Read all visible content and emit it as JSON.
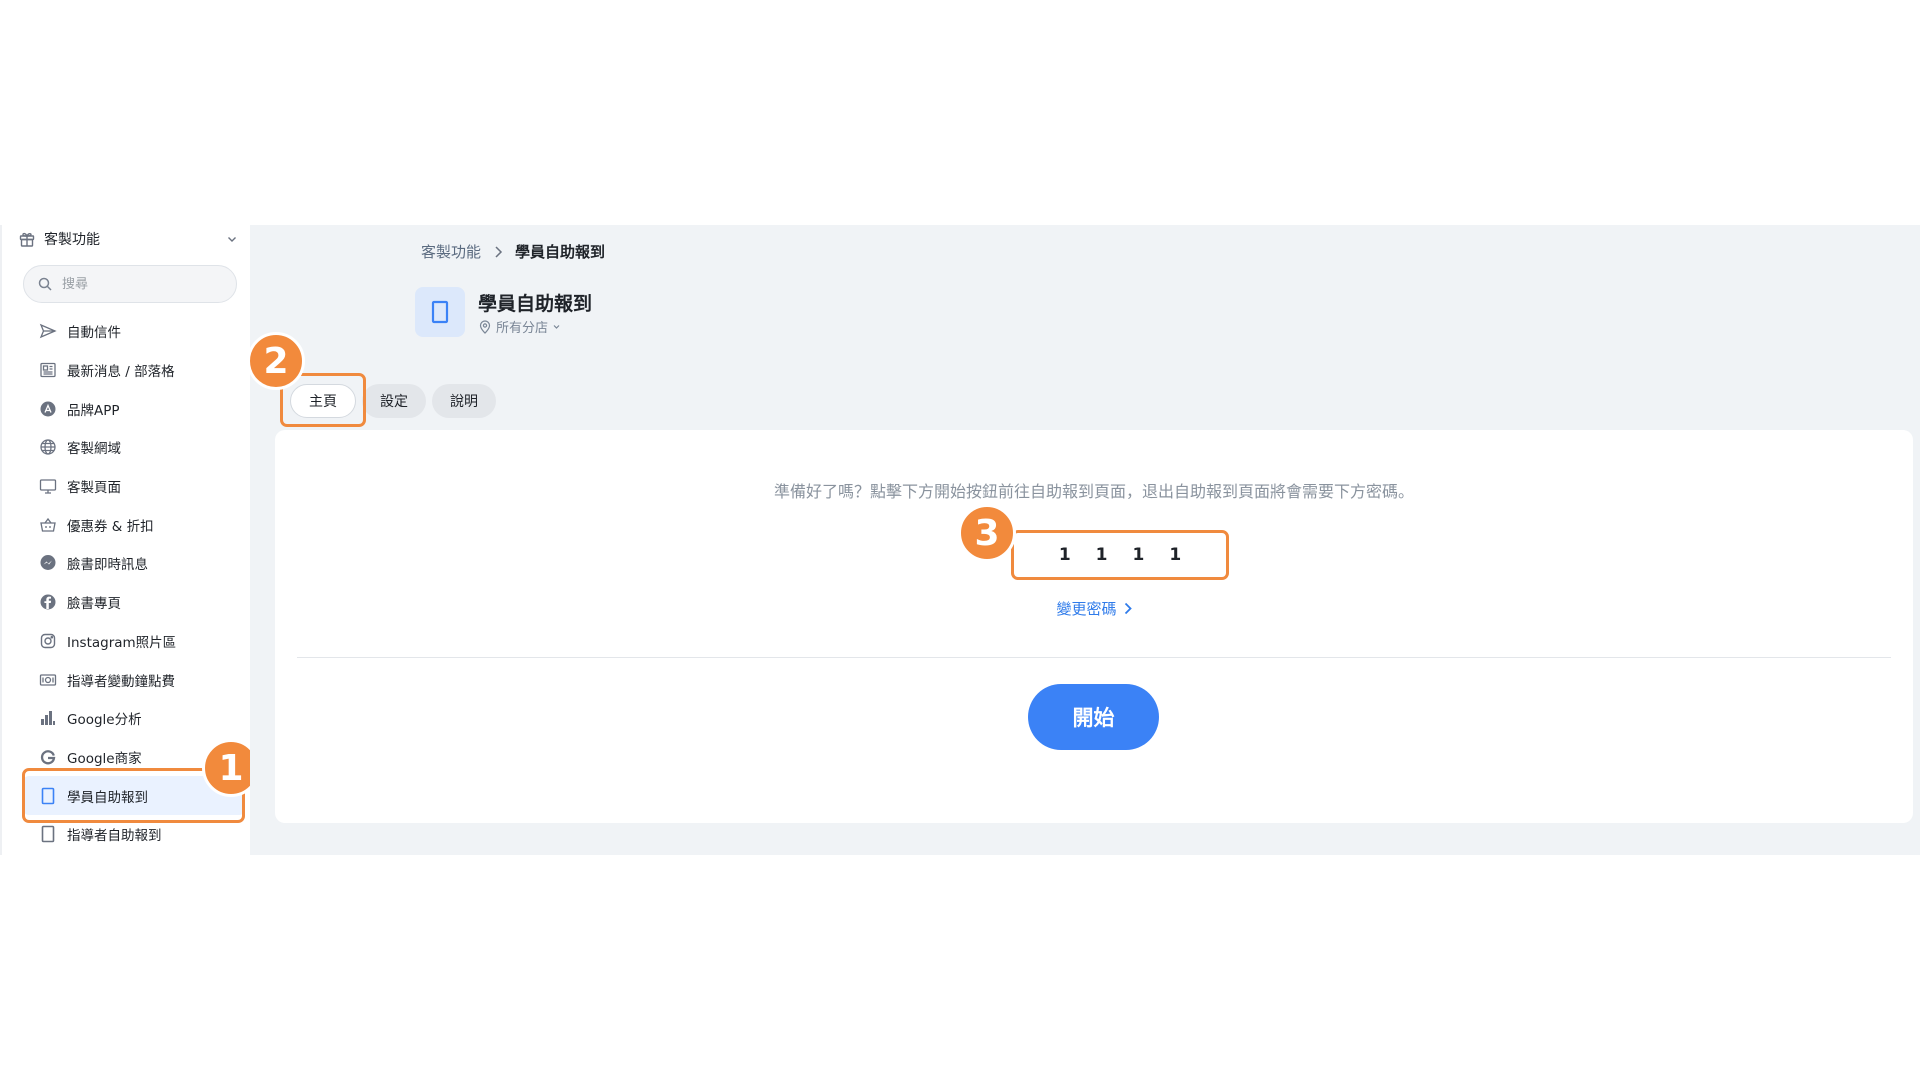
{
  "sidebar": {
    "header_label": "客製功能",
    "search_placeholder": "搜尋",
    "items": [
      {
        "label": "自動信件",
        "icon": "send-icon"
      },
      {
        "label": "最新消息 / 部落格",
        "icon": "news-icon"
      },
      {
        "label": "品牌APP",
        "icon": "app-icon"
      },
      {
        "label": "客製網域",
        "icon": "globe-icon"
      },
      {
        "label": "客製頁面",
        "icon": "monitor-icon"
      },
      {
        "label": "優惠券 & 折扣",
        "icon": "basket-icon"
      },
      {
        "label": "臉書即時訊息",
        "icon": "messenger-icon"
      },
      {
        "label": "臉書專頁",
        "icon": "facebook-icon"
      },
      {
        "label": "Instagram照片區",
        "icon": "instagram-icon"
      },
      {
        "label": "指導者變動鐘點費",
        "icon": "money-icon"
      },
      {
        "label": "Google分析",
        "icon": "analytics-icon"
      },
      {
        "label": "Google商家",
        "icon": "google-icon"
      },
      {
        "label": "學員自助報到",
        "icon": "tablet-icon",
        "active": true
      },
      {
        "label": "指導者自助報到",
        "icon": "tablet-icon"
      }
    ]
  },
  "breadcrumb": {
    "parent": "客製功能",
    "current": "學員自助報到"
  },
  "page": {
    "title": "學員自助報到",
    "branch": "所有分店"
  },
  "tabs": [
    {
      "label": "主頁",
      "active": true
    },
    {
      "label": "設定"
    },
    {
      "label": "說明"
    }
  ],
  "content": {
    "instruction": "準備好了嗎？點擊下方開始按鈕前往自助報到頁面，退出自助報到頁面將會需要下方密碼。",
    "password_digits": [
      "1",
      "1",
      "1",
      "1"
    ],
    "change_password": "變更密碼",
    "start_button": "開始"
  },
  "annotations": {
    "step1": "1",
    "step2": "2",
    "step3": "3"
  },
  "colors": {
    "accent": "#3b82f6",
    "highlight": "#f08a3e",
    "background": "#f0f3f6",
    "active_item": "#eaf2ff"
  }
}
